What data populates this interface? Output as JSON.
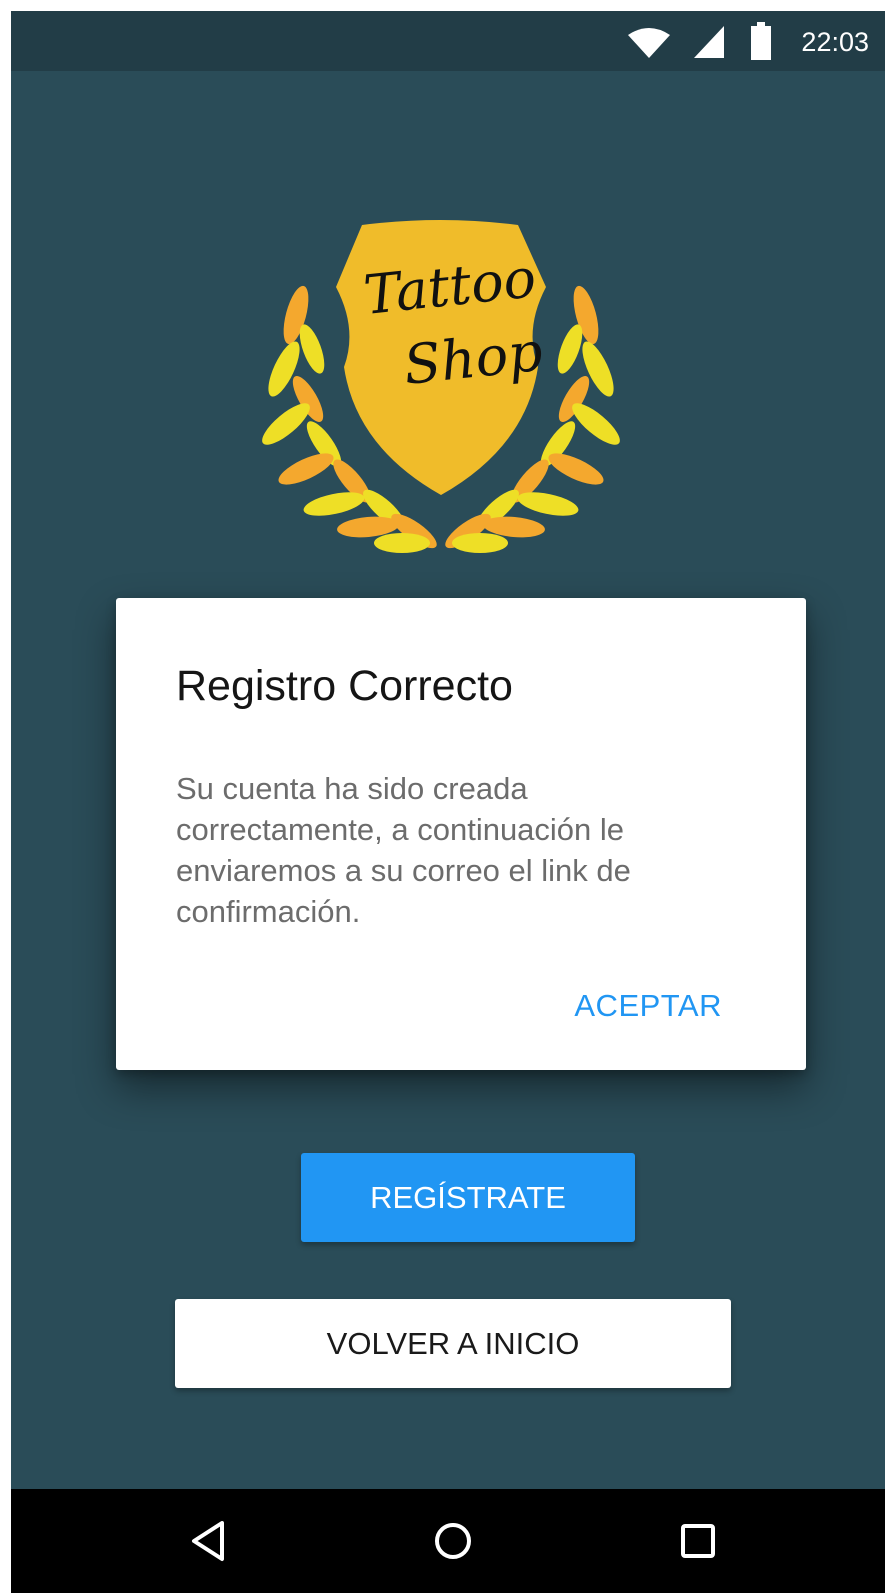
{
  "status_bar": {
    "time": "22:03",
    "icons": [
      "wifi-icon",
      "cell-signal-icon",
      "battery-icon"
    ]
  },
  "logo": {
    "name": "tattoo-shop-logo",
    "line1": "Tattoo",
    "line2": "Shop",
    "colors": {
      "shield": "#f0bc2a",
      "leaf_yellow": "#eedf26",
      "leaf_orange": "#f4a82e",
      "script": "#111111"
    }
  },
  "dialog": {
    "title": "Registro Correcto",
    "message": "Su cuenta ha sido creada correctamente, a continuación le enviaremos a su correo el link de confirmación.",
    "accept_label": "ACEPTAR"
  },
  "buttons": {
    "register_label": "REGÍSTRATE",
    "home_label": "VOLVER A INICIO"
  },
  "nav_bar": {
    "icons": [
      "back-icon",
      "home-icon",
      "recents-icon"
    ]
  },
  "colors": {
    "background": "#2a4c58",
    "status_bar": "#223d47",
    "accent": "#2196f3",
    "nav_bar": "#000000"
  }
}
